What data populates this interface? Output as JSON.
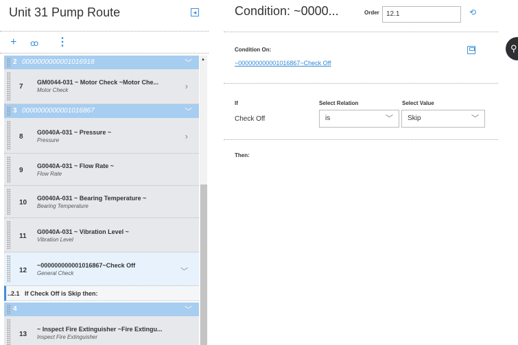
{
  "left": {
    "title": "Unit 31 Pump Route",
    "collapse_icon": "collapse-panel-icon",
    "toolbar": {
      "add": "+",
      "search": "ꝏ",
      "more": "⋮"
    },
    "groups": [
      {
        "num": "2",
        "id": "0000000000001016918"
      },
      {
        "num": "3",
        "id": "0000000000001016867"
      },
      {
        "num": "4",
        "id": ""
      }
    ],
    "items": [
      {
        "num": "7",
        "title": "GM0044-031 ~ Motor Check ~Motor Che...",
        "subtitle": "Motor Check"
      },
      {
        "num": "8",
        "title": "G0040A-031 ~ Pressure ~",
        "subtitle": "Pressure"
      },
      {
        "num": "9",
        "title": "G0040A-031 ~ Flow Rate ~",
        "subtitle": "Flow Rate"
      },
      {
        "num": "10",
        "title": "G0040A-031 ~ Bearing Temperature ~",
        "subtitle": "Bearing Temperature"
      },
      {
        "num": "11",
        "title": "G0040A-031 ~ Vibration Level ~",
        "subtitle": "Vibration Level"
      },
      {
        "num": "12",
        "title": "~000000000001016867~Check Off",
        "subtitle": "General Check"
      },
      {
        "num": "13",
        "title": "~ Inspect Fire Extinguisher ~Fire Extingu...",
        "subtitle": "Inspect Fire Extinguisher"
      }
    ],
    "condition_row": {
      "num": "..2.1",
      "text": "If Check Off is Skip then:"
    }
  },
  "right": {
    "title": "Condition: ~0000...",
    "order_label": "Order",
    "order_value": "12.1",
    "condition_on_label": "Condition On:",
    "condition_on_link": "~000000000001016867~Check Off",
    "col_if": "If",
    "col_relation": "Select Relation",
    "col_value": "Select Value",
    "if_value": "Check Off",
    "relation_value": "is",
    "value_value": "Skip",
    "then_label": "Then:"
  },
  "colors": {
    "accent": "#3b8fd9",
    "group_header": "#a7cdf0",
    "item_bg": "#e6e8eb",
    "selected_bg": "#e7f2fc"
  }
}
